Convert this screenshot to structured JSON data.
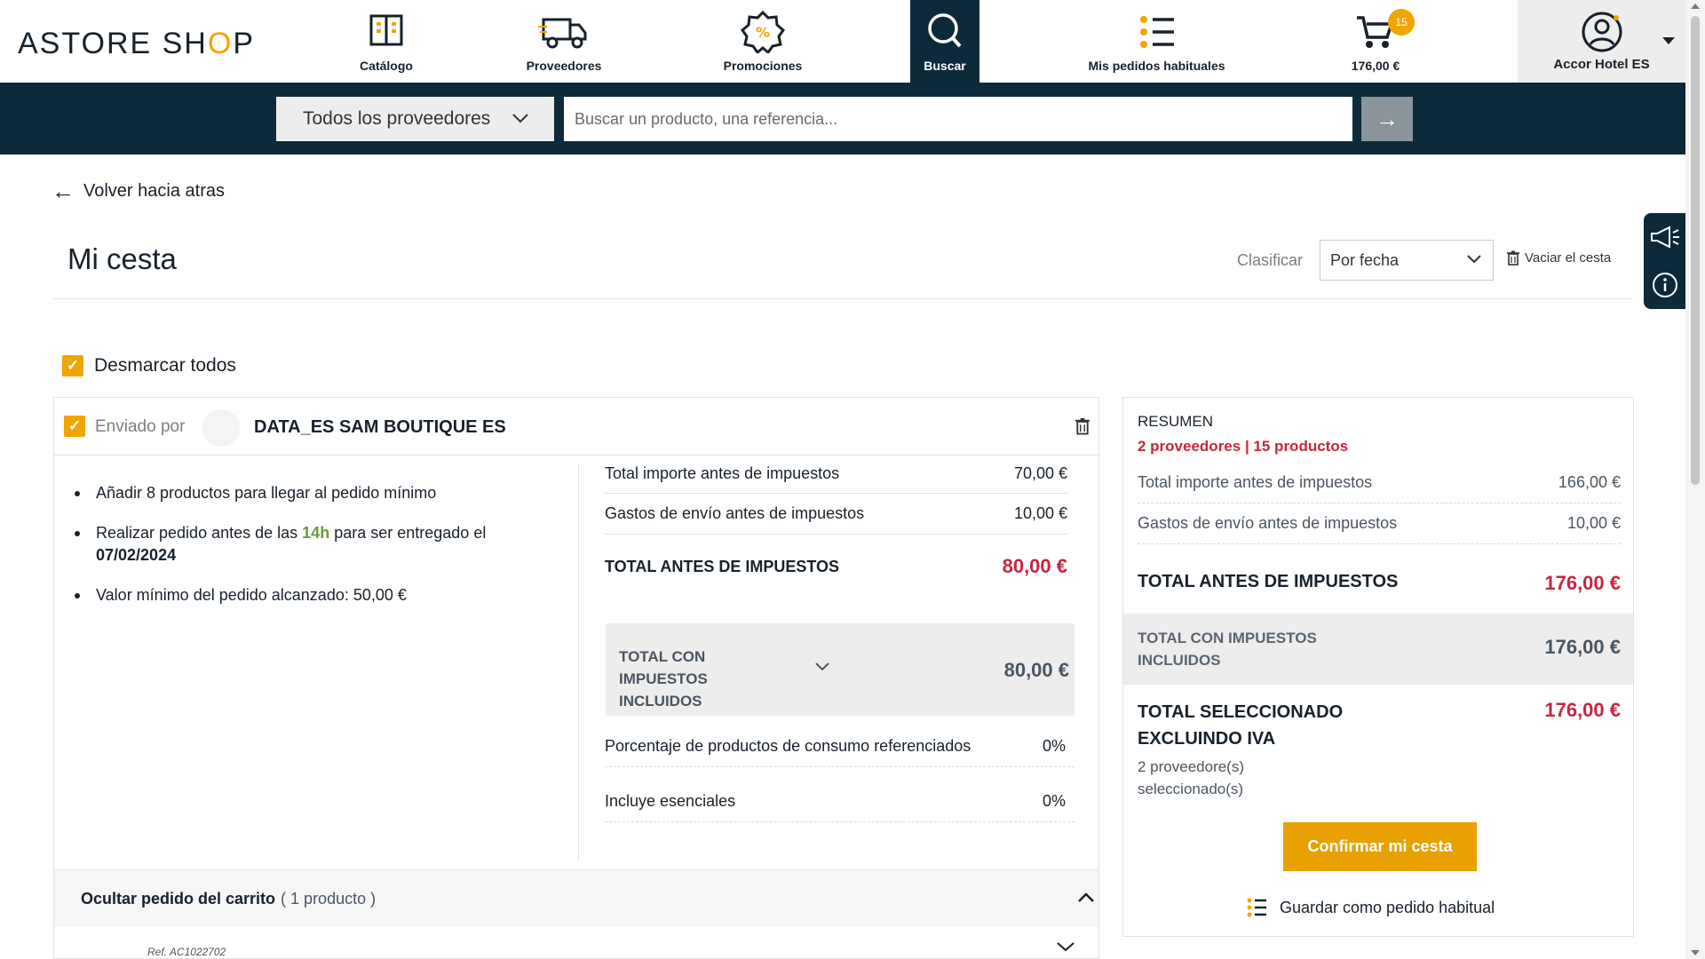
{
  "header": {
    "logo_text": "ASTORE SH",
    "logo_o": "O",
    "logo_end": "P",
    "nav": [
      {
        "label": "Catálogo",
        "icon": "catalog-book-icon"
      },
      {
        "label": "Proveedores",
        "icon": "delivery-truck-icon"
      },
      {
        "label": "Promociones",
        "icon": "percent-badge-icon"
      },
      {
        "label": "Buscar",
        "icon": "search-icon"
      },
      {
        "label": "Mis pedidos habituales",
        "icon": "checklist-icon"
      },
      {
        "label": "176,00 €",
        "icon": "cart-icon"
      }
    ],
    "cart_count": "15",
    "account_label": "Accor Hotel ES"
  },
  "search": {
    "supplier_filter": "Todos los proveedores",
    "placeholder": "Buscar un producto, una referencia...",
    "go_glyph": "→"
  },
  "page": {
    "back_label": "Volver hacia atras",
    "title": "Mi cesta",
    "sort_label": "Clasificar",
    "sort_value": "Por fecha",
    "empty_cart_label": "Vaciar el cesta",
    "unmark_all_label": "Desmarcar todos"
  },
  "supplier_order": {
    "sent_by_label": "Enviado por",
    "supplier_name": "DATA_ES SAM BOUTIQUE ES",
    "notes": {
      "min_products": "Añadir 8 productos para llegar al pedido mínimo",
      "deadline_pre": "Realizar pedido antes de las",
      "deadline_hour": "14h",
      "deadline_mid": "para ser entregado el",
      "deadline_date": "07/02/2024",
      "min_reached": "Valor mínimo del pedido alcanzado: 50,00 €"
    },
    "totals": {
      "subtotal_label": "Total importe antes de impuestos",
      "subtotal_value": "70,00 €",
      "shipping_label": "Gastos de envío antes de impuestos",
      "shipping_value": "10,00 €",
      "total_pre_tax_label": "TOTAL ANTES DE IMPUESTOS",
      "total_pre_tax_value": "80,00 €",
      "total_with_tax_label": "TOTAL CON IMPUESTOS INCLUIDOS",
      "total_with_tax_value": "80,00 €",
      "ref_pct_label": "Porcentaje de productos de consumo referenciados",
      "ref_pct_value": "0%",
      "essentials_label": "Incluye esenciales",
      "essentials_value": "0%"
    },
    "hide_label": "Ocultar pedido del carrito",
    "hide_count": "( 1 producto )",
    "ref_partial": "Ref. AC1022702"
  },
  "summary": {
    "title": "RESUMEN",
    "subtitle": "2 proveedores | 15 productos",
    "subtotal_label": "Total importe antes de impuestos",
    "subtotal_value": "166,00 €",
    "shipping_label": "Gastos de envío antes de impuestos",
    "shipping_value": "10,00 €",
    "total_pre_tax_label": "TOTAL ANTES DE IMPUESTOS",
    "total_pre_tax_value": "176,00 €",
    "total_with_tax_label": "TOTAL CON IMPUESTOS INCLUIDOS",
    "total_with_tax_value": "176,00 €",
    "selected_label": "TOTAL SELECCIONADO EXCLUINDO IVA",
    "selected_value": "176,00 €",
    "selected_note": "2 proveedore(s) seleccionado(s)",
    "confirm_label": "Confirmar mi cesta",
    "save_habitual_label": "Guardar como pedido habitual"
  },
  "colors": {
    "navy": "#0d2a3a",
    "accent": "#f0a500",
    "price_red": "#c8253f",
    "deadline_green": "#6c9a3a"
  }
}
